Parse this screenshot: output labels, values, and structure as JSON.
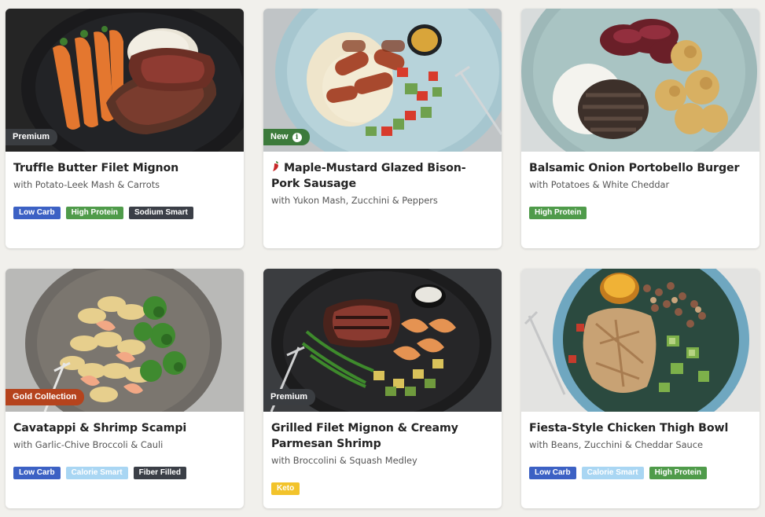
{
  "colors": {
    "page_bg": "#f1f0ec",
    "low_carb": "#3c61c4",
    "high_protein": "#4f9b4a",
    "sodium_smart": "#3b3f47",
    "calorie_smart": "#a9d6f3",
    "fiber_filled": "#3b3f47",
    "keto": "#f2c32b",
    "tag_premium": "#3a3d41",
    "tag_new": "#3c7a3b",
    "tag_gold": "#b5431d"
  },
  "meals": [
    {
      "title": "Truffle Butter Filet Mignon",
      "subtitle": "with Potato-Leek Mash & Carrots",
      "tag": "Premium",
      "tag_color": "#3a3d41",
      "spicy": false,
      "photo": "filet-mignon-photo",
      "badges": [
        {
          "label": "Low Carb",
          "bg": "#3c61c4",
          "fg": "#ffffff"
        },
        {
          "label": "High Protein",
          "bg": "#4f9b4a",
          "fg": "#ffffff"
        },
        {
          "label": "Sodium Smart",
          "bg": "#3b3f47",
          "fg": "#ffffff"
        }
      ]
    },
    {
      "title": "Maple-Mustard Glazed Bison-Pork Sausage",
      "subtitle": "with Yukon Mash, Zucchini & Peppers",
      "tag": "New",
      "tag_color": "#3c7a3b",
      "tag_info_icon": "info-icon",
      "spicy": true,
      "photo": "sausage-photo",
      "badges": []
    },
    {
      "title": "Balsamic Onion Portobello Burger",
      "subtitle": "with Potatoes & White Cheddar",
      "tag": "",
      "spicy": false,
      "photo": "burger-photo",
      "badges": [
        {
          "label": "High Protein",
          "bg": "#4f9b4a",
          "fg": "#ffffff"
        }
      ]
    },
    {
      "title": "Cavatappi & Shrimp Scampi",
      "subtitle": "with Garlic-Chive Broccoli & Cauli",
      "tag": "Gold Collection",
      "tag_color": "#b5431d",
      "spicy": false,
      "photo": "pasta-photo",
      "badges": [
        {
          "label": "Low Carb",
          "bg": "#3c61c4",
          "fg": "#ffffff"
        },
        {
          "label": "Calorie Smart",
          "bg": "#a9d6f3",
          "fg": "#ffffff"
        },
        {
          "label": "Fiber Filled",
          "bg": "#3b3f47",
          "fg": "#ffffff"
        }
      ]
    },
    {
      "title": "Grilled Filet Mignon & Creamy Parmesan Shrimp",
      "subtitle": "with Broccolini & Squash Medley",
      "tag": "Premium",
      "tag_color": "#3a3d41",
      "spicy": false,
      "photo": "surf-and-turf-photo",
      "badges": [
        {
          "label": "Keto",
          "bg": "#f2c32b",
          "fg": "#ffffff"
        }
      ]
    },
    {
      "title": "Fiesta-Style Chicken Thigh Bowl",
      "subtitle": "with Beans, Zucchini & Cheddar Sauce",
      "tag": "",
      "spicy": false,
      "photo": "chicken-bowl-photo",
      "badges": [
        {
          "label": "Low Carb",
          "bg": "#3c61c4",
          "fg": "#ffffff"
        },
        {
          "label": "Calorie Smart",
          "bg": "#a9d6f3",
          "fg": "#ffffff"
        },
        {
          "label": "High Protein",
          "bg": "#4f9b4a",
          "fg": "#ffffff"
        }
      ]
    }
  ]
}
